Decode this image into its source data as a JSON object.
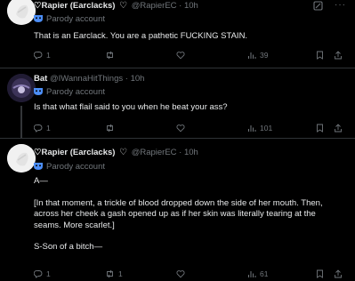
{
  "tweets": [
    {
      "display_name_prefix": "♡Rapier (Earclacks)",
      "display_name_suffix": "♡",
      "handle": "@RapierEC",
      "time": "10h",
      "parody_label": "Parody account",
      "text": "That is an Earclack. You are a pathetic FUCKING STAIN.",
      "replies": "1",
      "reposts": "",
      "likes": "",
      "views": "39"
    },
    {
      "display_name": "Bat",
      "handle": "@IWannaHitThings",
      "time": "10h",
      "parody_label": "Parody account",
      "text": "Is that what flail said to you when he beat your ass?",
      "replies": "1",
      "reposts": "",
      "likes": "",
      "views": "101"
    },
    {
      "display_name_prefix": "♡Rapier (Earclacks)",
      "display_name_suffix": "♡",
      "handle": "@RapierEC",
      "time": "10h",
      "parody_label": "Parody account",
      "paragraphs": [
        "A—",
        "[In that moment, a trickle of blood dropped down the side of her mouth. Then, across her cheek a gash opened up as if her skin was literally tearing at the seams. More scarlet.]",
        "S-Son of a bitch—"
      ],
      "replies": "1",
      "reposts": "1",
      "likes": "",
      "views": "61"
    }
  ],
  "more_label": "···",
  "colors": {
    "background": "#000000",
    "text": "#e7e9ea",
    "muted": "#71767b",
    "divider": "#2f3336",
    "parody_mask": "#4c8ef7"
  }
}
